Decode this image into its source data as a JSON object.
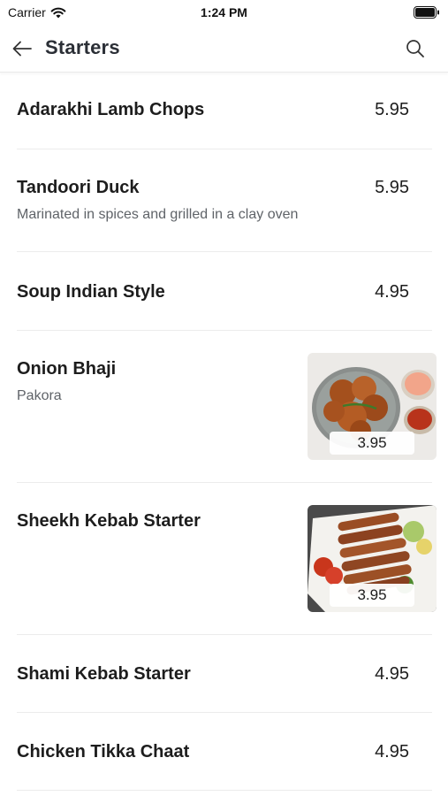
{
  "status_bar": {
    "carrier": "Carrier",
    "time": "1:24 PM"
  },
  "header": {
    "title": "Starters",
    "back_icon": "arrow-left-icon",
    "search_icon": "search-icon"
  },
  "items": [
    {
      "name": "Adarakhi Lamb Chops",
      "description": "",
      "price": "5.95"
    },
    {
      "name": "Tandoori Duck",
      "description": "Marinated in spices and grilled in a clay oven",
      "price": "5.95"
    },
    {
      "name": "Soup Indian Style",
      "description": "",
      "price": "4.95"
    },
    {
      "name": "Onion Bhaji",
      "description": "Pakora",
      "price": "3.95"
    },
    {
      "name": "Sheekh Kebab Starter",
      "description": "",
      "price": "3.95"
    },
    {
      "name": "Shami Kebab Starter",
      "description": "",
      "price": "4.95"
    },
    {
      "name": "Chicken Tikka Chaat",
      "description": "",
      "price": "4.95"
    }
  ]
}
